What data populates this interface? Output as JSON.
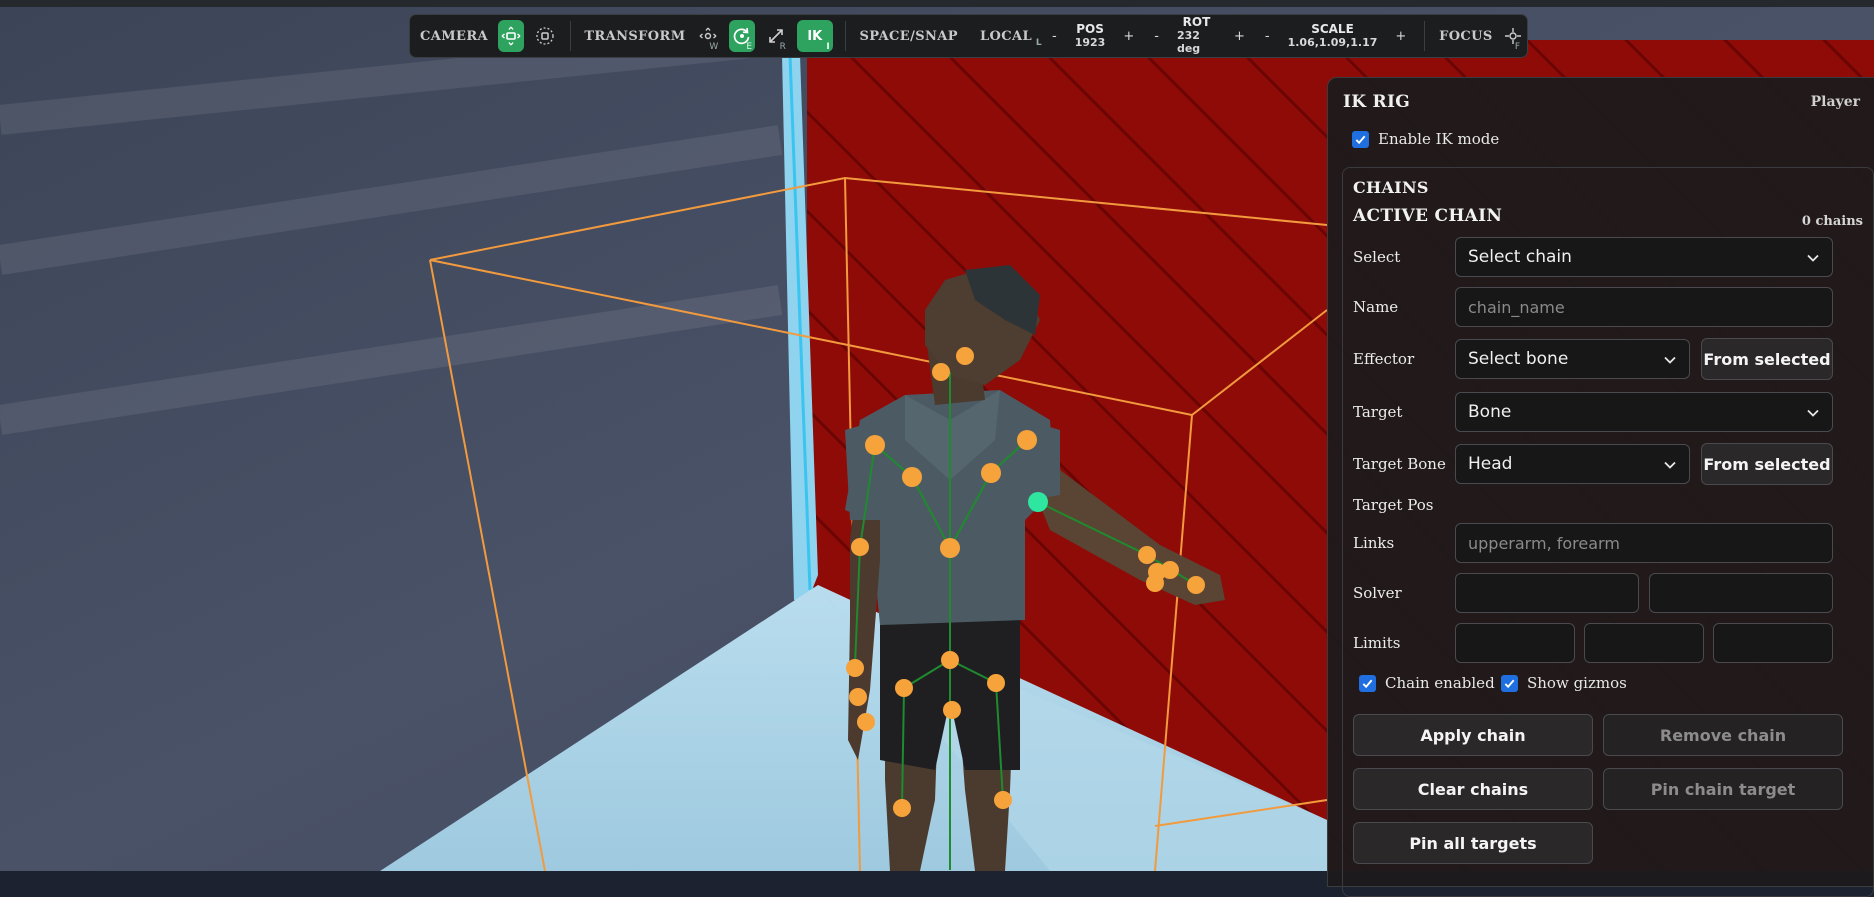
{
  "toolbar": {
    "camera_label": "CAMERA",
    "transform_label": "TRANSFORM",
    "translate_key": "W",
    "rotate_key": "E",
    "scale_key": "R",
    "ik_label": "IK",
    "ik_key": "I",
    "space_snap_label": "SPACE/SNAP",
    "local_label": "LOCAL",
    "local_key": "L",
    "minus": "-",
    "plus": "+",
    "pos_label": "POS",
    "pos_value": "1923",
    "rot_label": "ROT",
    "rot_value": "232 deg",
    "scale_label": "SCALE",
    "scale_value": "1.06,1.09,1.17",
    "focus_label": "FOCUS",
    "focus_key": "F",
    "accent_color": "#2ea35f"
  },
  "panel": {
    "title": "IK RIG",
    "tag": "Player",
    "enable_ik_label": "Enable IK mode",
    "enable_ik_checked": true,
    "chains_title": "CHAINS",
    "active_chain_title": "ACTIVE CHAIN",
    "chain_count": "0 chains",
    "select_label": "Select",
    "select_value": "Select chain",
    "name_label": "Name",
    "name_placeholder": "chain_name",
    "effector_label": "Effector",
    "effector_value": "Select bone",
    "from_selected_label": "From selected",
    "target_label": "Target",
    "target_value": "Bone",
    "target_bone_label": "Target Bone",
    "target_bone_value": "Head",
    "target_pos_label": "Target Pos",
    "links_label": "Links",
    "links_placeholder": "upperarm, forearm",
    "solver_label": "Solver",
    "limits_label": "Limits",
    "chain_enabled_label": "Chain enabled",
    "chain_enabled_checked": true,
    "show_gizmos_label": "Show gizmos",
    "show_gizmos_checked": true,
    "apply_chain_label": "Apply chain",
    "remove_chain_label": "Remove chain",
    "clear_chains_label": "Clear chains",
    "pin_chain_target_label": "Pin chain target",
    "pin_all_targets_label": "Pin all targets",
    "checkbox_color": "#1f6fe0"
  },
  "scene": {
    "joint_color": "#f7a33c",
    "selected_joint_color": "#2fe6a0",
    "bone_line_color": "#1f8a2e",
    "bounding_box_color": "#f29a3e",
    "wall_color": "#8b0a06",
    "floor_color": "#a9d2e6"
  }
}
